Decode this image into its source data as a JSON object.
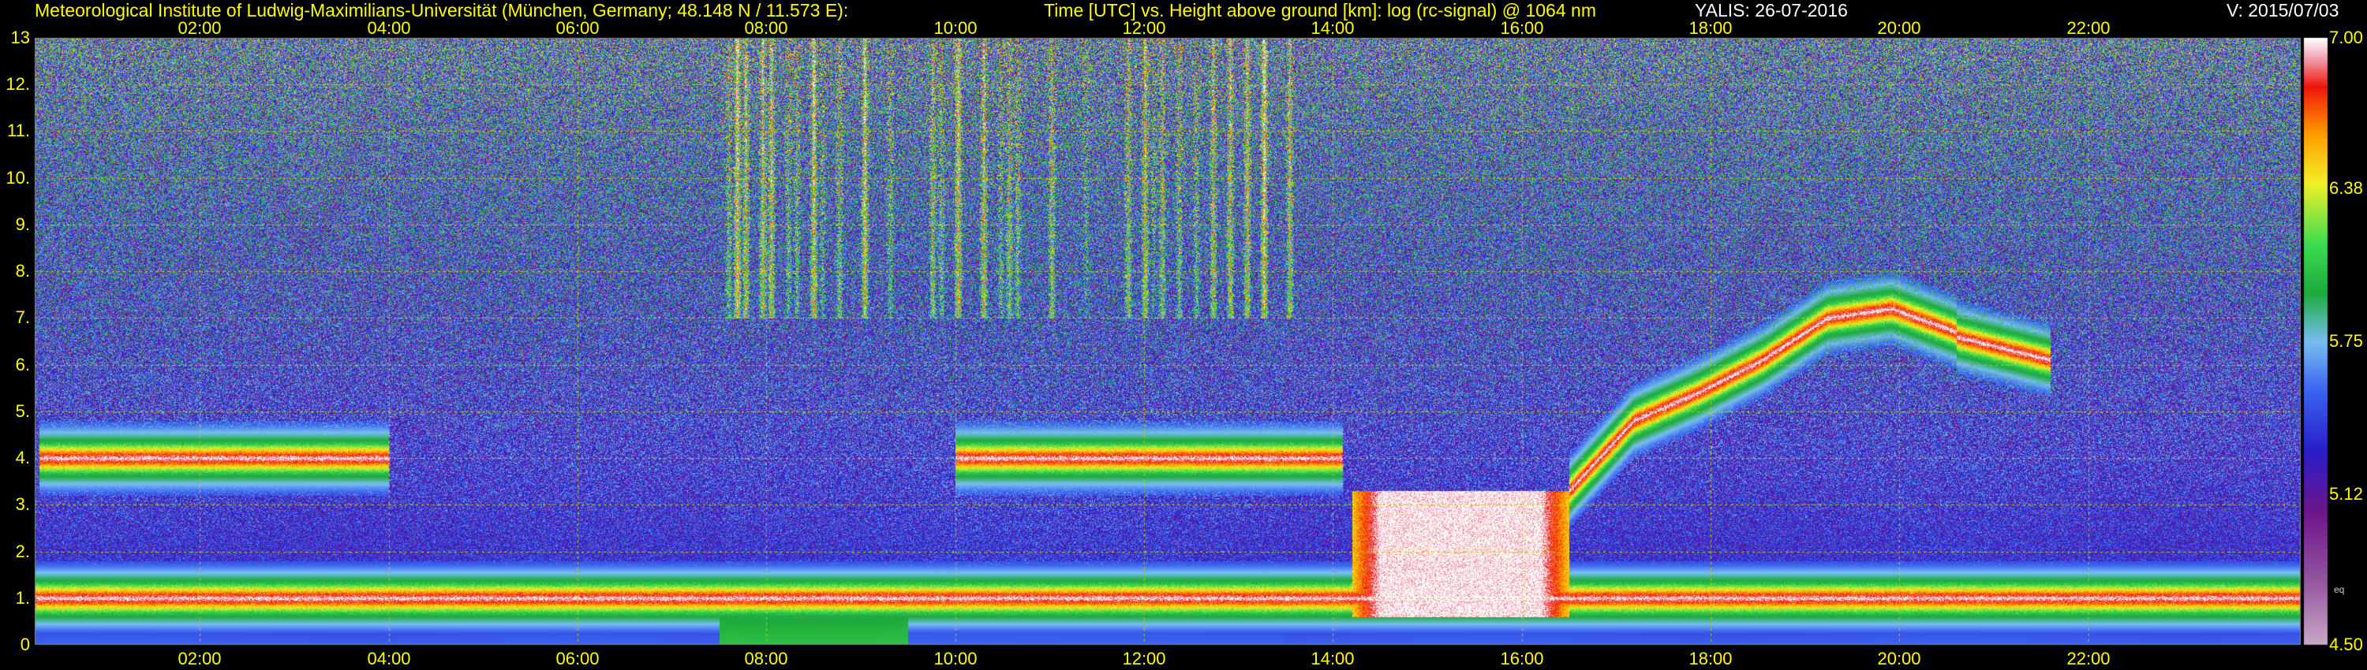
{
  "header": {
    "institute": "Meteorological Institute of Ludwig-Maximilians-Universität (München, Germany; 48.148 N / 11.573 E):",
    "title": "Time [UTC] vs. Height above ground [km]: log (rc-signal) @ 1064 nm",
    "station_date": "YALIS: 26-07-2016",
    "version": "V: 2015/07/03"
  },
  "colorbar": {
    "labels": [
      "7.00",
      "6.38",
      "5.75",
      "5.12",
      "4.50"
    ],
    "small_label": "eq"
  },
  "colors": {
    "background": "#000000",
    "text": "#ffff00",
    "grid": "#c8c800"
  },
  "chart_data": {
    "type": "heatmap",
    "title": "Time [UTC] vs. Height above ground [km]: log (rc-signal) @ 1064 nm",
    "xlabel": "Time [UTC]",
    "ylabel": "Height above ground [km]",
    "x_unit": "hour UTC",
    "xlim": [
      0.25,
      24.25
    ],
    "ylim": [
      0,
      13
    ],
    "x_ticks": [
      2,
      4,
      6,
      8,
      10,
      12,
      14,
      16,
      18,
      20,
      22
    ],
    "x_tick_labels": [
      "02:00",
      "04:00",
      "06:00",
      "08:00",
      "10:00",
      "12:00",
      "14:00",
      "16:00",
      "18:00",
      "20:00",
      "22:00"
    ],
    "y_ticks": [
      0,
      1,
      2,
      3,
      4,
      5,
      6,
      7,
      8,
      9,
      10,
      11,
      12,
      13
    ],
    "y_tick_labels": [
      "0",
      "1.",
      "2.",
      "3.",
      "4.",
      "5.",
      "6.",
      "7.",
      "8.",
      "9.",
      "10.",
      "11.",
      "12.",
      "13"
    ],
    "color_scale": {
      "min": 4.5,
      "max": 7.0,
      "ticks": [
        7.0,
        6.38,
        5.75,
        5.12,
        4.5
      ]
    },
    "grid": true,
    "features": [
      {
        "name": "cloud layer",
        "t_start": 0.3,
        "t_end": 4.0,
        "height_km": 4.0
      },
      {
        "name": "boundary layer",
        "t_start": 0.25,
        "t_end": 24.25,
        "height_km": 1.0
      },
      {
        "name": "convective cloud",
        "t_start": 14.2,
        "t_end": 16.5,
        "base_km": 0.6,
        "top_km": 3.3
      },
      {
        "name": "cloud layer",
        "t_start": 16.5,
        "t_end": 20.6,
        "height_km": [
          3.3,
          4.8,
          5.4,
          6.1,
          7.0,
          7.2,
          6.7
        ]
      },
      {
        "name": "cloud layer",
        "t_start": 20.6,
        "t_end": 21.6,
        "height_km": [
          6.6,
          6.1
        ]
      },
      {
        "name": "cloud fragments",
        "t_start": 10.0,
        "t_end": 14.1,
        "height_km": 4.0
      }
    ]
  }
}
